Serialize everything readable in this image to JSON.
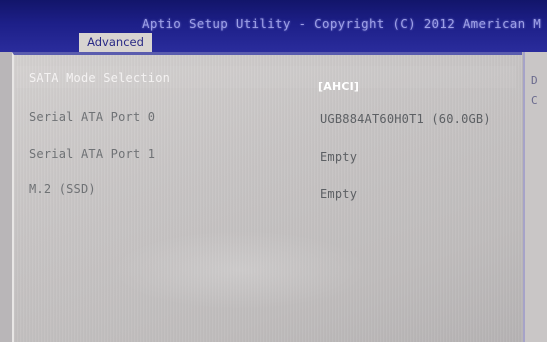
{
  "window": {
    "title": "Aptio Setup Utility - Copyright (C) 2012 American M"
  },
  "tabs": [
    {
      "label": "Advanced",
      "active": true
    }
  ],
  "settings": [
    {
      "label": "SATA Mode Selection",
      "value": "[AHCI]",
      "selected": true
    },
    {
      "label": "Serial ATA Port 0",
      "value": "UGB884AT60H0T1 (60.0GB)",
      "selected": false
    },
    {
      "label": "Serial ATA Port 1",
      "value": "Empty",
      "selected": false
    },
    {
      "label": "M.2 (SSD)",
      "value": "Empty",
      "selected": false
    }
  ],
  "help_panel": {
    "fragments": [
      "D",
      "C"
    ]
  },
  "colors": {
    "title_bar": "#1d1f88",
    "title_text": "#9da0e6",
    "panel_bg": "#c7c4c4",
    "selected_text": "#f4f2f2",
    "normal_text": "#6f7275"
  }
}
